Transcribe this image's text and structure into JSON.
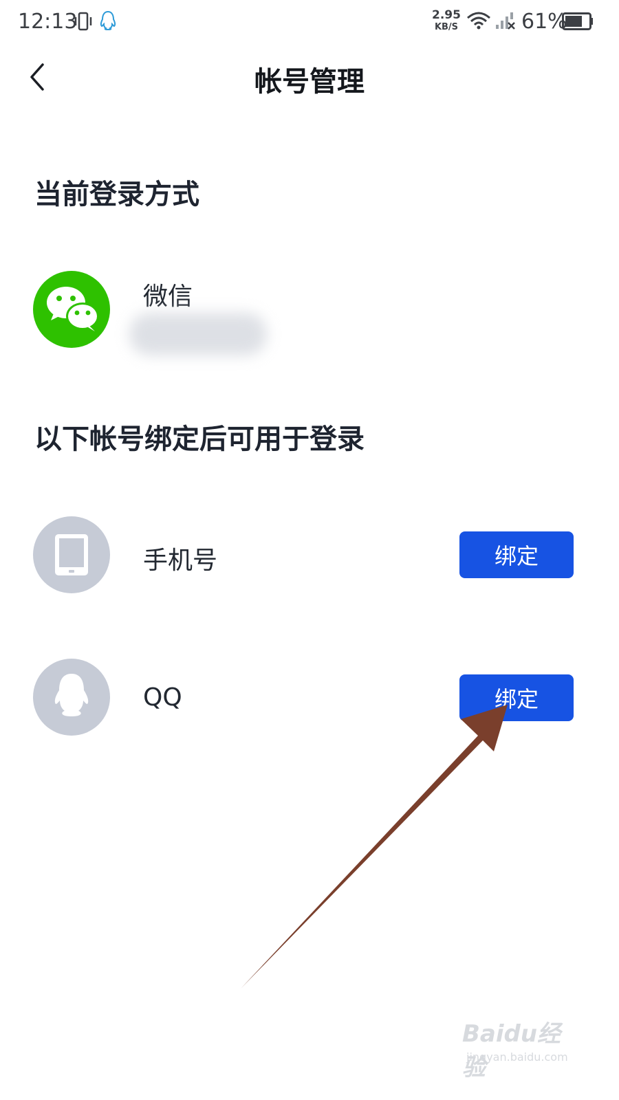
{
  "status_bar": {
    "time": "12:13",
    "net_speed_value": "2.95",
    "net_speed_unit": "KB/S",
    "battery_percent": "61%",
    "icons": [
      "vibrate-icon",
      "qq-notification-icon",
      "wifi-icon",
      "signal-icon",
      "battery-icon"
    ]
  },
  "header": {
    "title": "帐号管理",
    "back_icon": "chevron-left-icon"
  },
  "current_login": {
    "section_title": "当前登录方式",
    "method": {
      "name": "微信",
      "icon": "wechat-icon",
      "icon_bg": "#2ec100"
    }
  },
  "bindable": {
    "section_title": "以下帐号绑定后可用于登录",
    "items": [
      {
        "name": "手机号",
        "icon": "phone-icon",
        "button_label": "绑定"
      },
      {
        "name": "QQ",
        "icon": "qq-icon",
        "button_label": "绑定"
      }
    ]
  },
  "colors": {
    "accent": "#1753e3",
    "avatar_grey": "#c6cbd6",
    "arrow": "#7a3f2c"
  },
  "watermark": {
    "line1": "Baidu经验",
    "line2": "jingyan.baidu.com"
  }
}
